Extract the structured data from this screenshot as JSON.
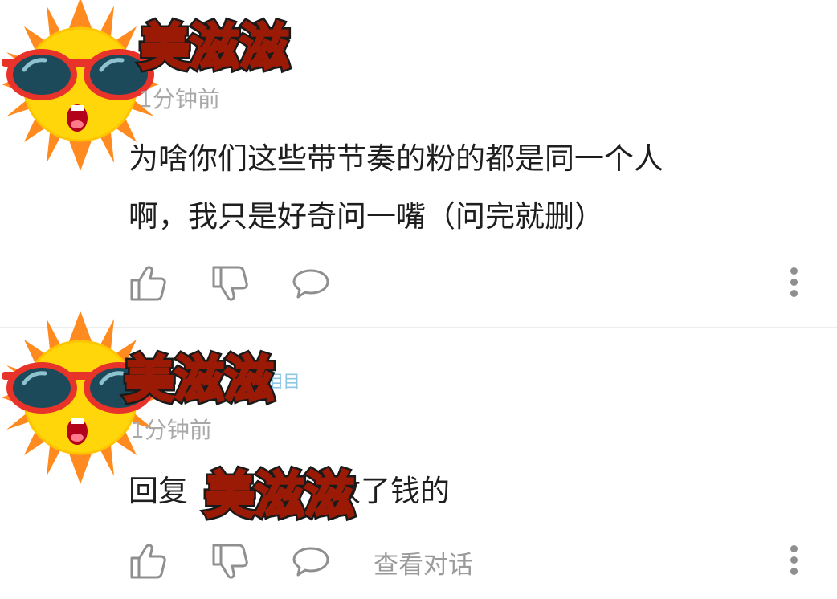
{
  "sticker": {
    "text": "美滋滋"
  },
  "comments": [
    {
      "username": "",
      "timestamp": "1分钟前",
      "text_line1": "为啥你们这些带节奏的粉的都是同一个人",
      "text_line2": "啊，我只是好奇问一嘴（问完就删）",
      "view_thread_label": ""
    },
    {
      "username": "泪目",
      "timestamp": "1分钟前",
      "text_before": "回复",
      "text_after": "收了钱的",
      "view_thread_label": "查看对话"
    }
  ],
  "icons": {
    "avatar": "sun-sunglasses-icon",
    "like": "thumbs-up-icon",
    "dislike": "thumbs-down-icon",
    "reply": "speech-bubble-icon",
    "more": "more-vertical-icon"
  },
  "colors": {
    "text": "#1e1e1e",
    "meta": "#a8a8a8",
    "icon": "#8f8f8f",
    "divider": "#ececec",
    "sun": "#ffd60a",
    "sun_rays": "#ff8a1f",
    "sticker_fill": "#ff9a1a",
    "sticker_outline": "#9b1a06"
  }
}
